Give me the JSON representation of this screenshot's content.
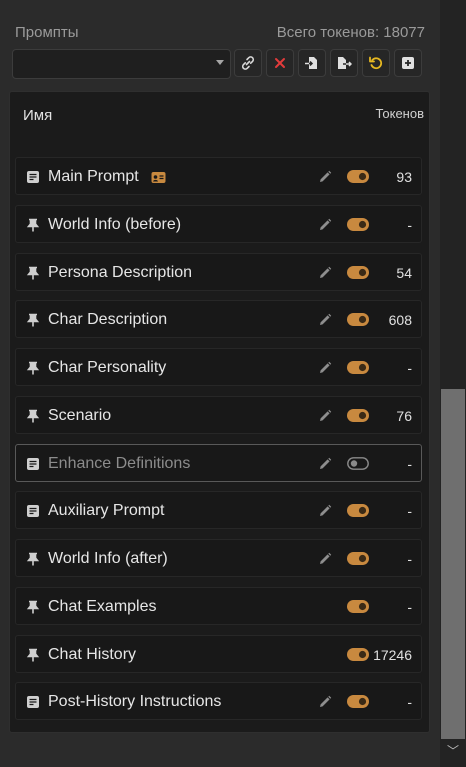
{
  "header": {
    "prompts_label": "Промпты",
    "tokens_total": "Всего токенов: 18077"
  },
  "toolbar": {
    "select_value": "",
    "buttons": [
      "link-icon",
      "close-icon",
      "import-icon",
      "export-icon",
      "reset-icon",
      "add-icon"
    ]
  },
  "table": {
    "col_name": "Имя",
    "col_tokens": "Токенов",
    "rows": [
      {
        "name": "Main Prompt",
        "icon": "document-icon",
        "badge": "id-card-icon",
        "editable": true,
        "enabled": true,
        "tokens": "93"
      },
      {
        "name": "World Info (before)",
        "icon": "pin-icon",
        "editable": true,
        "enabled": true,
        "tokens": "-"
      },
      {
        "name": "Persona Description",
        "icon": "pin-icon",
        "editable": true,
        "enabled": true,
        "tokens": "54"
      },
      {
        "name": "Char Description",
        "icon": "pin-icon",
        "editable": true,
        "enabled": true,
        "tokens": "608"
      },
      {
        "name": "Char Personality",
        "icon": "pin-icon",
        "editable": true,
        "enabled": true,
        "tokens": "-"
      },
      {
        "name": "Scenario",
        "icon": "pin-icon",
        "editable": true,
        "enabled": true,
        "tokens": "76"
      },
      {
        "name": "Enhance Definitions",
        "icon": "document-icon",
        "editable": true,
        "enabled": false,
        "tokens": "-"
      },
      {
        "name": "Auxiliary Prompt",
        "icon": "document-icon",
        "editable": true,
        "enabled": true,
        "tokens": "-"
      },
      {
        "name": "World Info (after)",
        "icon": "pin-icon",
        "editable": true,
        "enabled": true,
        "tokens": "-"
      },
      {
        "name": "Chat Examples",
        "icon": "pin-icon",
        "editable": false,
        "enabled": true,
        "tokens": "-"
      },
      {
        "name": "Chat History",
        "icon": "pin-icon",
        "editable": false,
        "enabled": true,
        "tokens": "17246"
      },
      {
        "name": "Post-History Instructions",
        "icon": "document-icon",
        "editable": true,
        "enabled": true,
        "tokens": "-"
      }
    ]
  },
  "colors": {
    "accent_toggle": "#c8893f",
    "danger": "#e23b3b",
    "reset": "#e6b821",
    "badge": "#c8893f"
  }
}
